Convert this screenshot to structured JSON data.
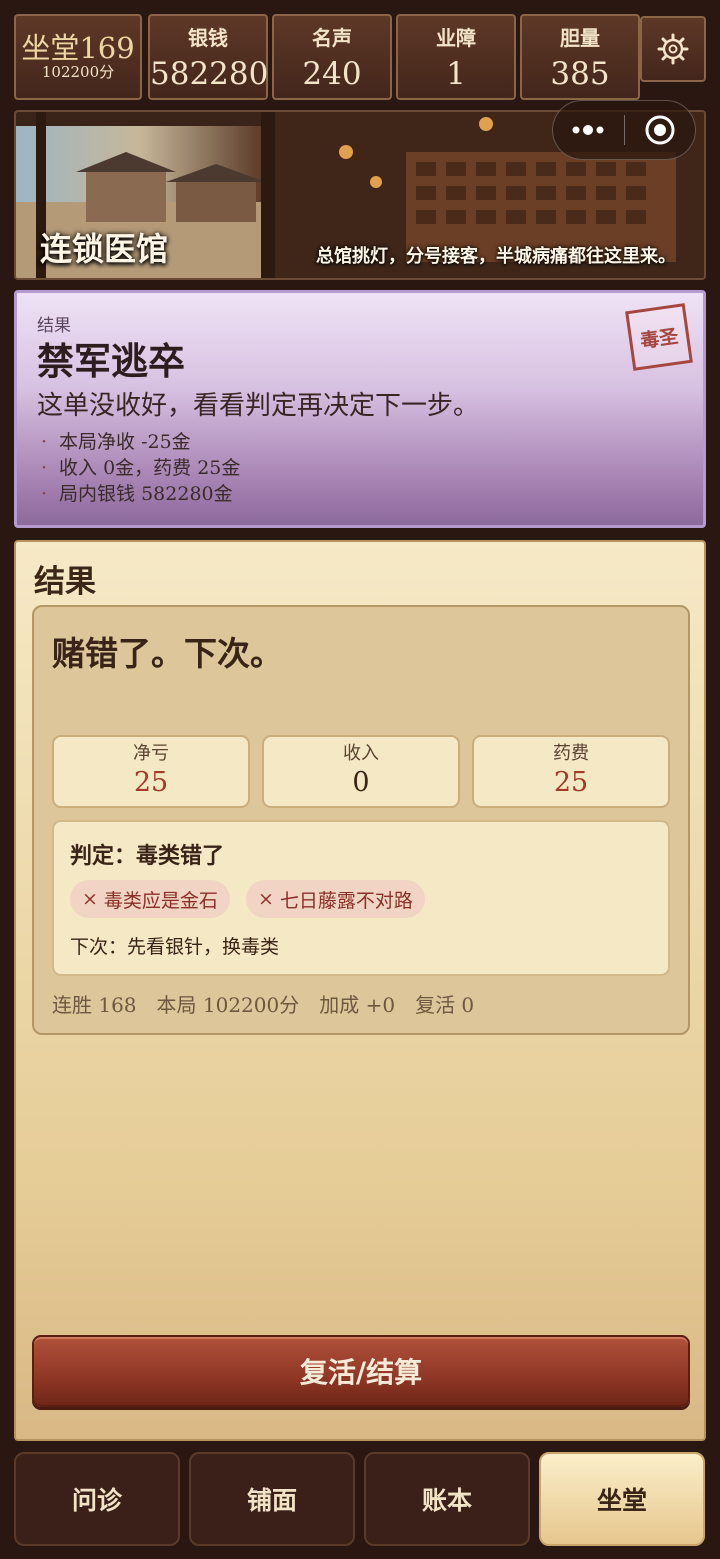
{
  "stats": {
    "rank_title": "坐堂169",
    "rank_score": "102200分",
    "items": [
      {
        "label": "银钱",
        "value": "582280"
      },
      {
        "label": "名声",
        "value": "240"
      },
      {
        "label": "业障",
        "value": "1"
      },
      {
        "label": "胆量",
        "value": "385"
      }
    ],
    "settings_icon": "gear-icon"
  },
  "banner": {
    "title": "连锁医馆",
    "slogan": "总馆挑灯，分号接客，半城病痛都往这里来。",
    "capsule_icons": [
      "more-dots-icon",
      "target-close-icon"
    ]
  },
  "result": {
    "eyebrow": "结果",
    "headline": "禁军逃卒",
    "subtitle": "这单没收好，看看判定再决定下一步。",
    "bullets": [
      "本局净收 -25金",
      "收入 0金，药费 25金",
      "局内银钱 582280金"
    ],
    "seal": "毒圣"
  },
  "panel": {
    "title": "结果",
    "quote": "赌错了。下次。",
    "metrics": [
      {
        "label": "净亏",
        "value": "25",
        "color": "#a33a2c"
      },
      {
        "label": "收入",
        "value": "0",
        "color": "#3a2418"
      },
      {
        "label": "药费",
        "value": "25",
        "color": "#a33a2c"
      }
    ],
    "verdict": {
      "title": "判定：毒类错了",
      "chips": [
        "毒类应是金石",
        "七日藤露不对路"
      ],
      "chip_mark": "×",
      "next": "下次：先看银针，换毒类"
    },
    "footer": "连胜 168　本局 102200分　加成 +0　复活 0",
    "cta": "复活/结算"
  },
  "tabs": [
    {
      "label": "问诊",
      "active": false
    },
    {
      "label": "铺面",
      "active": false
    },
    {
      "label": "账本",
      "active": false
    },
    {
      "label": "坐堂",
      "active": true
    }
  ]
}
